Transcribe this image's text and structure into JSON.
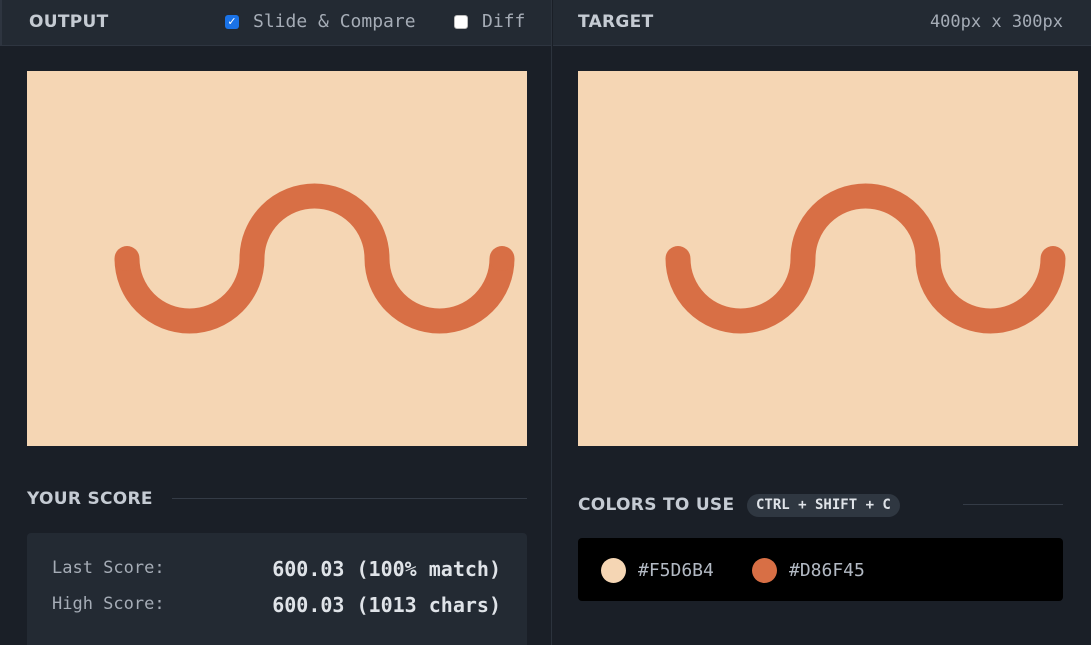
{
  "output": {
    "title": "OUTPUT",
    "slide_compare": {
      "label": "Slide & Compare",
      "checked": true
    },
    "diff": {
      "label": "Diff",
      "checked": false
    }
  },
  "target": {
    "title": "TARGET",
    "dimensions": "400px x 300px"
  },
  "score": {
    "section_title": "YOUR SCORE",
    "last_label": "Last Score:",
    "last_value": "600.03 (100% match)",
    "high_label": "High Score:",
    "high_value": "600.03 (1013 chars)"
  },
  "colors": {
    "section_title": "COLORS TO USE",
    "shortcut": "CTRL + SHIFT + C",
    "items": [
      {
        "hex": "#F5D6B4",
        "color": "#F5D6B4"
      },
      {
        "hex": "#D86F45",
        "color": "#D86F45"
      }
    ]
  },
  "icons": {
    "checkbox_checked": "checkmark-icon",
    "swatch": "color-dot-icon"
  }
}
